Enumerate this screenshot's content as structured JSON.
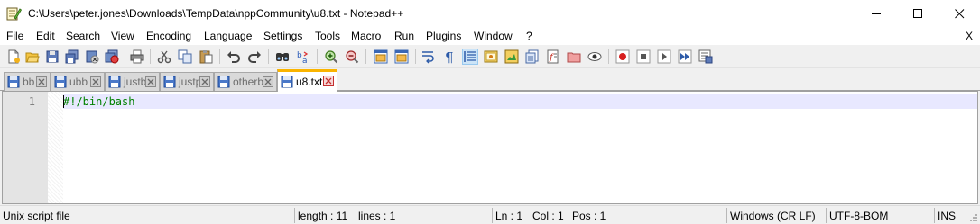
{
  "window": {
    "title": "C:\\Users\\peter.jones\\Downloads\\TempData\\nppCommunity\\u8.txt - Notepad++"
  },
  "menu": {
    "file": "File",
    "edit": "Edit",
    "search": "Search",
    "view": "View",
    "encoding": "Encoding",
    "language": "Language",
    "settings": "Settings",
    "tools": "Tools",
    "macro": "Macro",
    "run": "Run",
    "plugins": "Plugins",
    "window": "Window",
    "help": "?",
    "close_doc": "X"
  },
  "tabs": [
    {
      "label": "bb",
      "active": false
    },
    {
      "label": "ubb",
      "active": false
    },
    {
      "label": "justb",
      "active": false
    },
    {
      "label": "justp",
      "active": false
    },
    {
      "label": "otherb",
      "active": false
    },
    {
      "label": "u8.txt",
      "active": true
    }
  ],
  "editor": {
    "line_numbers": [
      "1"
    ],
    "lines": [
      "#!/bin/bash"
    ]
  },
  "status": {
    "language": "Unix script file",
    "length": "length : 11",
    "lines": "lines : 1",
    "ln": "Ln : 1",
    "col": "Col : 1",
    "pos": "Pos : 1",
    "eol": "Windows (CR LF)",
    "encoding": "UTF-8-BOM",
    "mode": "INS"
  },
  "colors": {
    "active_tab_accent": "#fab400",
    "current_line": "#e8e8ff",
    "code_text": "#008000",
    "toolbar_active": "#cce4f7"
  }
}
